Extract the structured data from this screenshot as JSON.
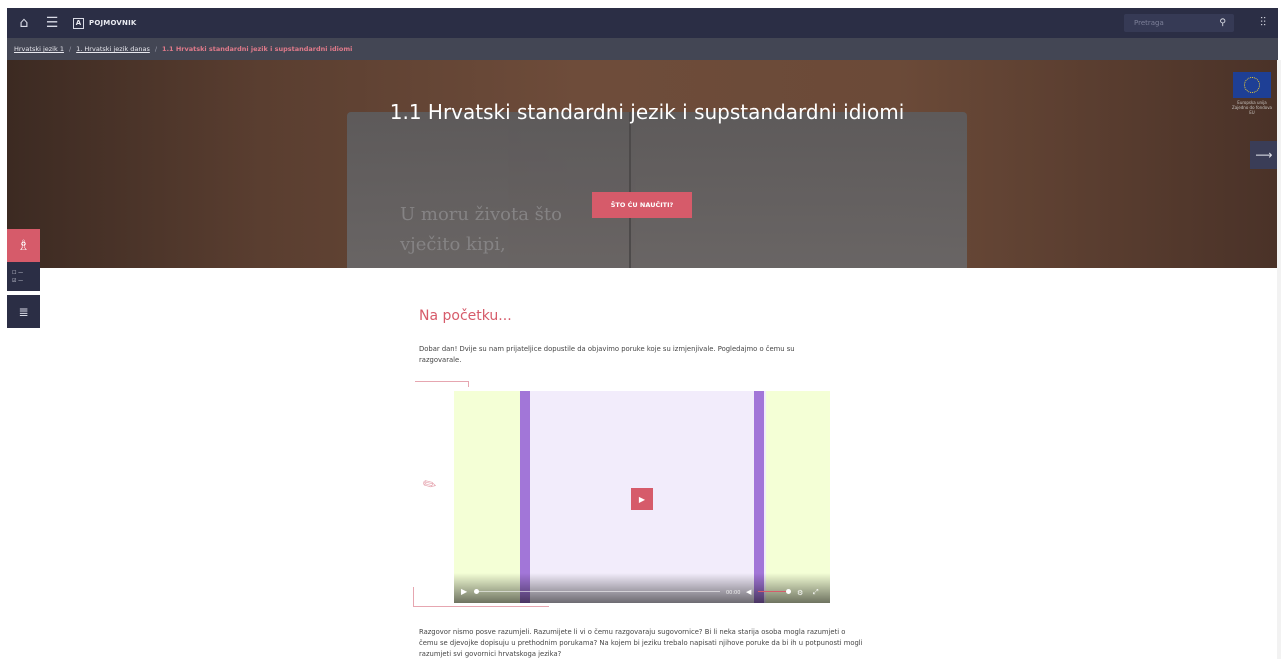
{
  "topbar": {
    "home_icon": "home-icon",
    "menu_icon": "hamburger-menu-icon",
    "pojmovnik_label": "POJMOVNIK",
    "pojmovnik_badge": "A",
    "search_placeholder": "Pretraga",
    "search_icon": "search-icon",
    "tools_icon": "settings-sliders-icon"
  },
  "breadcrumb": {
    "items": [
      "Hrvatski jezik 1",
      "1. Hrvatski jezik danas"
    ],
    "current": "1.1 Hrvatski standardni jezik i supstandardni idiomi"
  },
  "hero": {
    "title": "1.1 Hrvatski standardni jezik i supstandardni idiomi",
    "cta_label": "ŠTO ĆU NAUČITI?",
    "poem_line1": "U moru života što",
    "poem_line2": "vječito kipi,",
    "eu_caption": "Europska unija Zajedno do fondova EU"
  },
  "side_tools": {
    "t2_line1": "☐ —",
    "t2_line2": "☑ —"
  },
  "content": {
    "heading": "Na početku...",
    "intro": "Dobar dan! Dvije su nam prijateljice dopustile da objavimo poruke koje su izmjenjivale. Pogledajmo o čemu su razgovarale.",
    "video_time": "00:00",
    "after_text": "Razgovor nismo posve razumjeli. Razumijete li vi o čemu razgovaraju sugovornice? Bi li neka starija osoba mogla razumjeti o čemu se djevojke dopisuju u prethodnim porukama? Na kojem bi jeziku trebalo napisati njihove poruke da bi ih u potpunosti mogli razumjeti svi govornici hrvatskoga jezika?"
  },
  "colors": {
    "nav": "#2b2e45",
    "accent": "#d65b6a",
    "video_bg": "#f4ffd6",
    "video_bar": "#a276d8"
  }
}
